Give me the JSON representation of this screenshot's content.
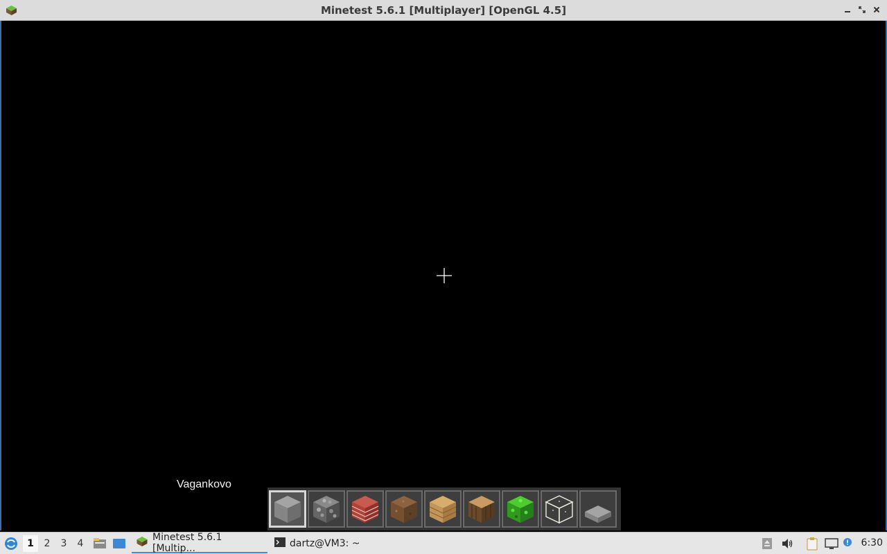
{
  "window": {
    "title": "Minetest 5.6.1 [Multiplayer] [OpenGL 4.5]",
    "app_icon": "minetest-icon",
    "controls": [
      "minimize-icon",
      "maximize-icon",
      "close-icon"
    ]
  },
  "game": {
    "location_label": "Vagankovo",
    "crosshair": "crosshair-icon",
    "hotbar": {
      "selected_index": 0,
      "slots": [
        {
          "item": "stone",
          "color": "#8a8a8a"
        },
        {
          "item": "cobblestone",
          "color": "#6e6e6e"
        },
        {
          "item": "brick",
          "color": "#b5433a"
        },
        {
          "item": "dirt",
          "color": "#7a5233"
        },
        {
          "item": "wood-planks",
          "color": "#c49a5a"
        },
        {
          "item": "tree-trunk",
          "color": "#7d5a35"
        },
        {
          "item": "leaves",
          "color": "#3fae2a"
        },
        {
          "item": "glass",
          "color": "#e6e6d8"
        },
        {
          "item": "stone-slab",
          "color": "#8c8c8c"
        }
      ]
    }
  },
  "taskbar": {
    "start_icon": "start-menu-icon",
    "workspaces": [
      "1",
      "2",
      "3",
      "4"
    ],
    "active_workspace": 0,
    "tasks": [
      {
        "label": "Minetest 5.6.1 [Multip...",
        "icon": "minetest-icon",
        "active": true
      },
      {
        "label": "dartz@VM3: ~",
        "icon": "terminal-icon",
        "active": false
      }
    ],
    "tray_icons": [
      "eject-icon",
      "volume-icon",
      "clipboard-icon",
      "network-icon",
      "notification-icon"
    ],
    "clock": "6:30"
  }
}
